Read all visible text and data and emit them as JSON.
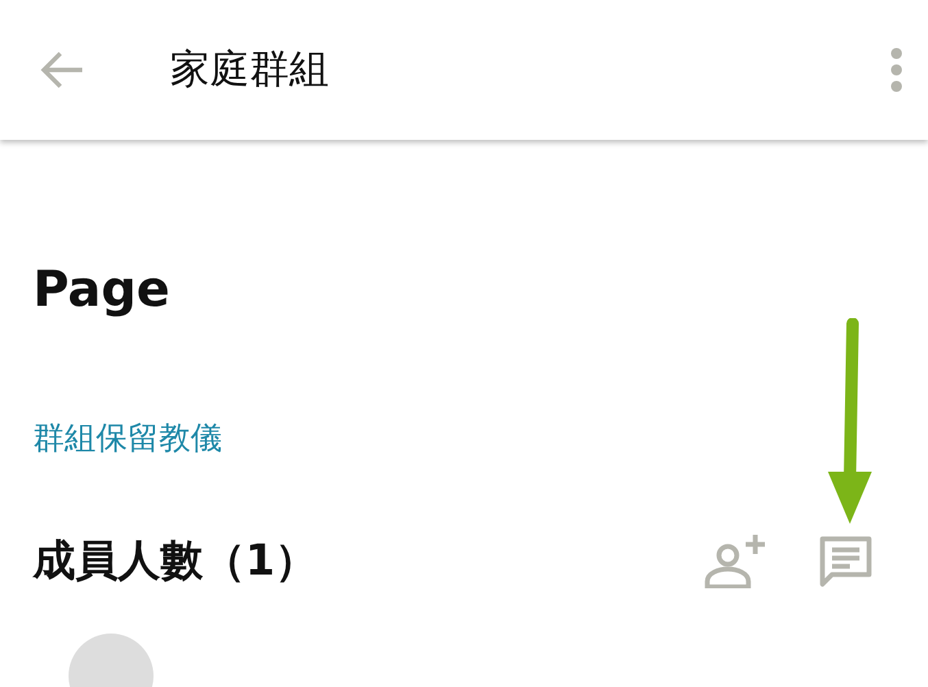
{
  "app_bar": {
    "title": "家庭群組"
  },
  "heading": "Page",
  "link": "群組保留教儀",
  "members": {
    "title": "成員人數（1）"
  }
}
